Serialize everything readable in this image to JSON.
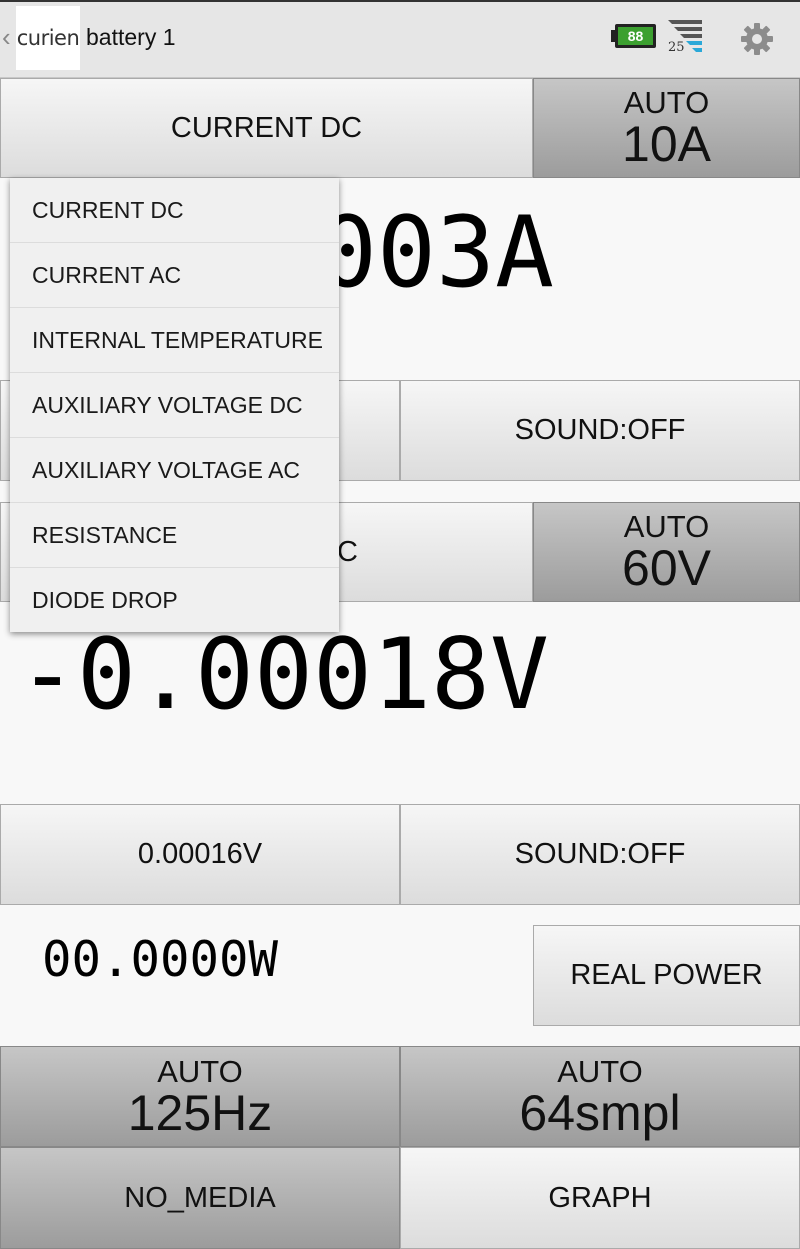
{
  "actionbar": {
    "logo_text": "curien",
    "title": "battery 1",
    "battery_level": "88",
    "signal_value": "25"
  },
  "channel1": {
    "mode_button": "CURRENT DC",
    "range_mode": "AUTO",
    "range_value": "10A",
    "reading_visible": "003A",
    "sound_button": "SOUND:OFF"
  },
  "channel2": {
    "mode_button_visible": "C",
    "range_mode": "AUTO",
    "range_value": "60V",
    "reading": "-0.00018V",
    "secondary_value_button": "0.00016V",
    "sound_button": "SOUND:OFF"
  },
  "power": {
    "reading": "00.0000W",
    "mode_button": "REAL POWER"
  },
  "sampling": {
    "rate_mode": "AUTO",
    "rate_value": "125Hz",
    "samples_mode": "AUTO",
    "samples_value": "64smpl"
  },
  "footer": {
    "media_button": "NO_MEDIA",
    "graph_button": "GRAPH"
  },
  "dropdown": {
    "items": [
      "CURRENT DC",
      "CURRENT AC",
      "INTERNAL TEMPERATURE",
      "AUXILIARY VOLTAGE DC",
      "AUXILIARY VOLTAGE AC",
      "RESISTANCE",
      "DIODE DROP"
    ]
  },
  "colors": {
    "battery_fill": "#3ca030",
    "signal_accent": "#2aa8d8"
  }
}
